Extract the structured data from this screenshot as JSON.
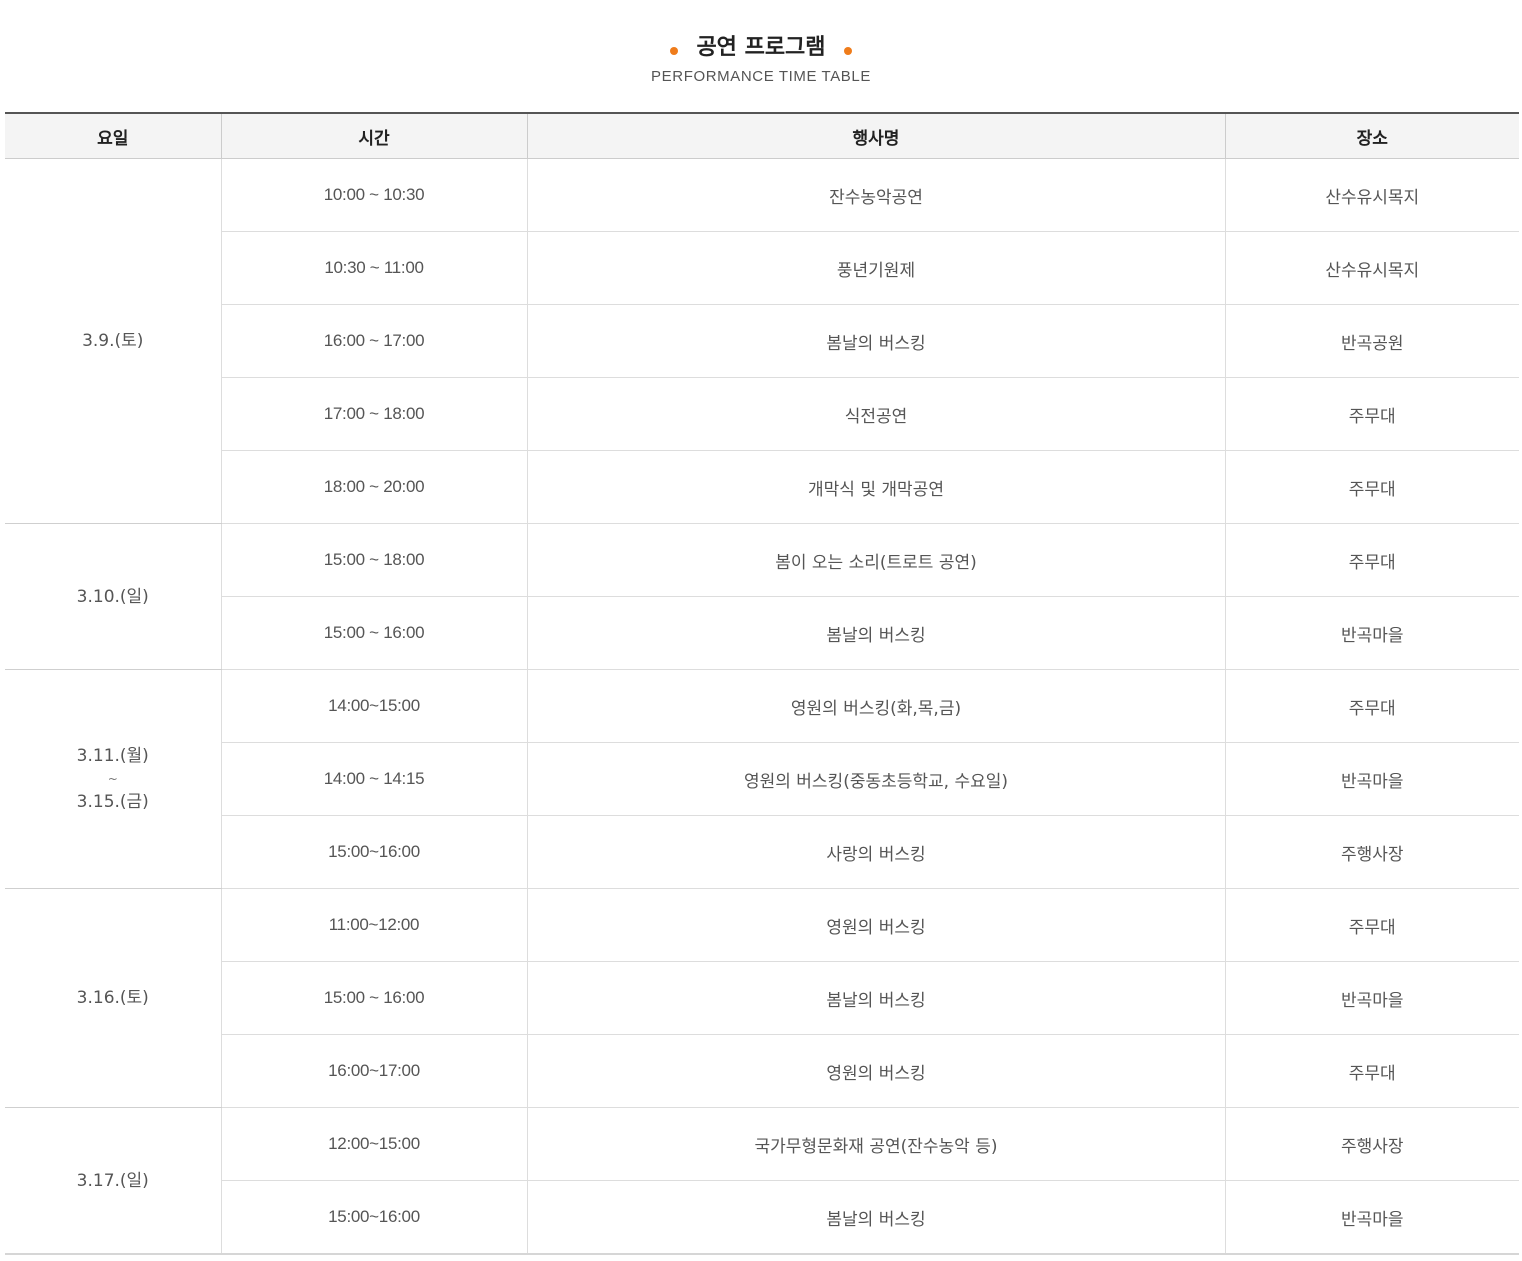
{
  "heading": {
    "title": "공연 프로그램",
    "subtitle": "PERFORMANCE TIME TABLE"
  },
  "colors": {
    "accent": "#ef7c1b",
    "header_bg": "#f4f4f4",
    "border": "#dddddd"
  },
  "table": {
    "columns": [
      "요일",
      "시간",
      "행사명",
      "장소"
    ],
    "days": [
      {
        "label": "3.9.(토)",
        "rows": [
          {
            "time": "10:00 ~ 10:30",
            "event": "잔수농악공연",
            "venue": "산수유시목지"
          },
          {
            "time": "10:30 ~ 11:00",
            "event": "풍년기원제",
            "venue": "산수유시목지"
          },
          {
            "time": "16:00 ~ 17:00",
            "event": "봄날의 버스킹",
            "venue": "반곡공원"
          },
          {
            "time": "17:00 ~ 18:00",
            "event": "식전공연",
            "venue": "주무대"
          },
          {
            "time": "18:00 ~ 20:00",
            "event": "개막식 및 개막공연",
            "venue": "주무대"
          }
        ]
      },
      {
        "label": "3.10.(일)",
        "rows": [
          {
            "time": "15:00 ~ 18:00",
            "event": "봄이 오는 소리(트로트 공연)",
            "venue": "주무대"
          },
          {
            "time": "15:00 ~ 16:00",
            "event": "봄날의 버스킹",
            "venue": "반곡마을"
          }
        ]
      },
      {
        "label": "3.11.(월)",
        "label_sep": "~",
        "label_end": "3.15.(금)",
        "rows": [
          {
            "time": "14:00~15:00",
            "event": "영원의 버스킹(화,목,금)",
            "venue": "주무대"
          },
          {
            "time": "14:00 ~ 14:15",
            "event": "영원의 버스킹(중동초등학교, 수요일)",
            "venue": "반곡마을"
          },
          {
            "time": "15:00~16:00",
            "event": "사랑의 버스킹",
            "venue": "주행사장"
          }
        ]
      },
      {
        "label": "3.16.(토)",
        "rows": [
          {
            "time": "11:00~12:00",
            "event": "영원의 버스킹",
            "venue": "주무대"
          },
          {
            "time": "15:00 ~ 16:00",
            "event": "봄날의 버스킹",
            "venue": "반곡마을"
          },
          {
            "time": "16:00~17:00",
            "event": "영원의 버스킹",
            "venue": "주무대"
          }
        ]
      },
      {
        "label": "3.17.(일)",
        "rows": [
          {
            "time": "12:00~15:00",
            "event": "국가무형문화재 공연(잔수농악 등)",
            "venue": "주행사장"
          },
          {
            "time": "15:00~16:00",
            "event": "봄날의 버스킹",
            "venue": "반곡마을"
          }
        ]
      }
    ]
  }
}
